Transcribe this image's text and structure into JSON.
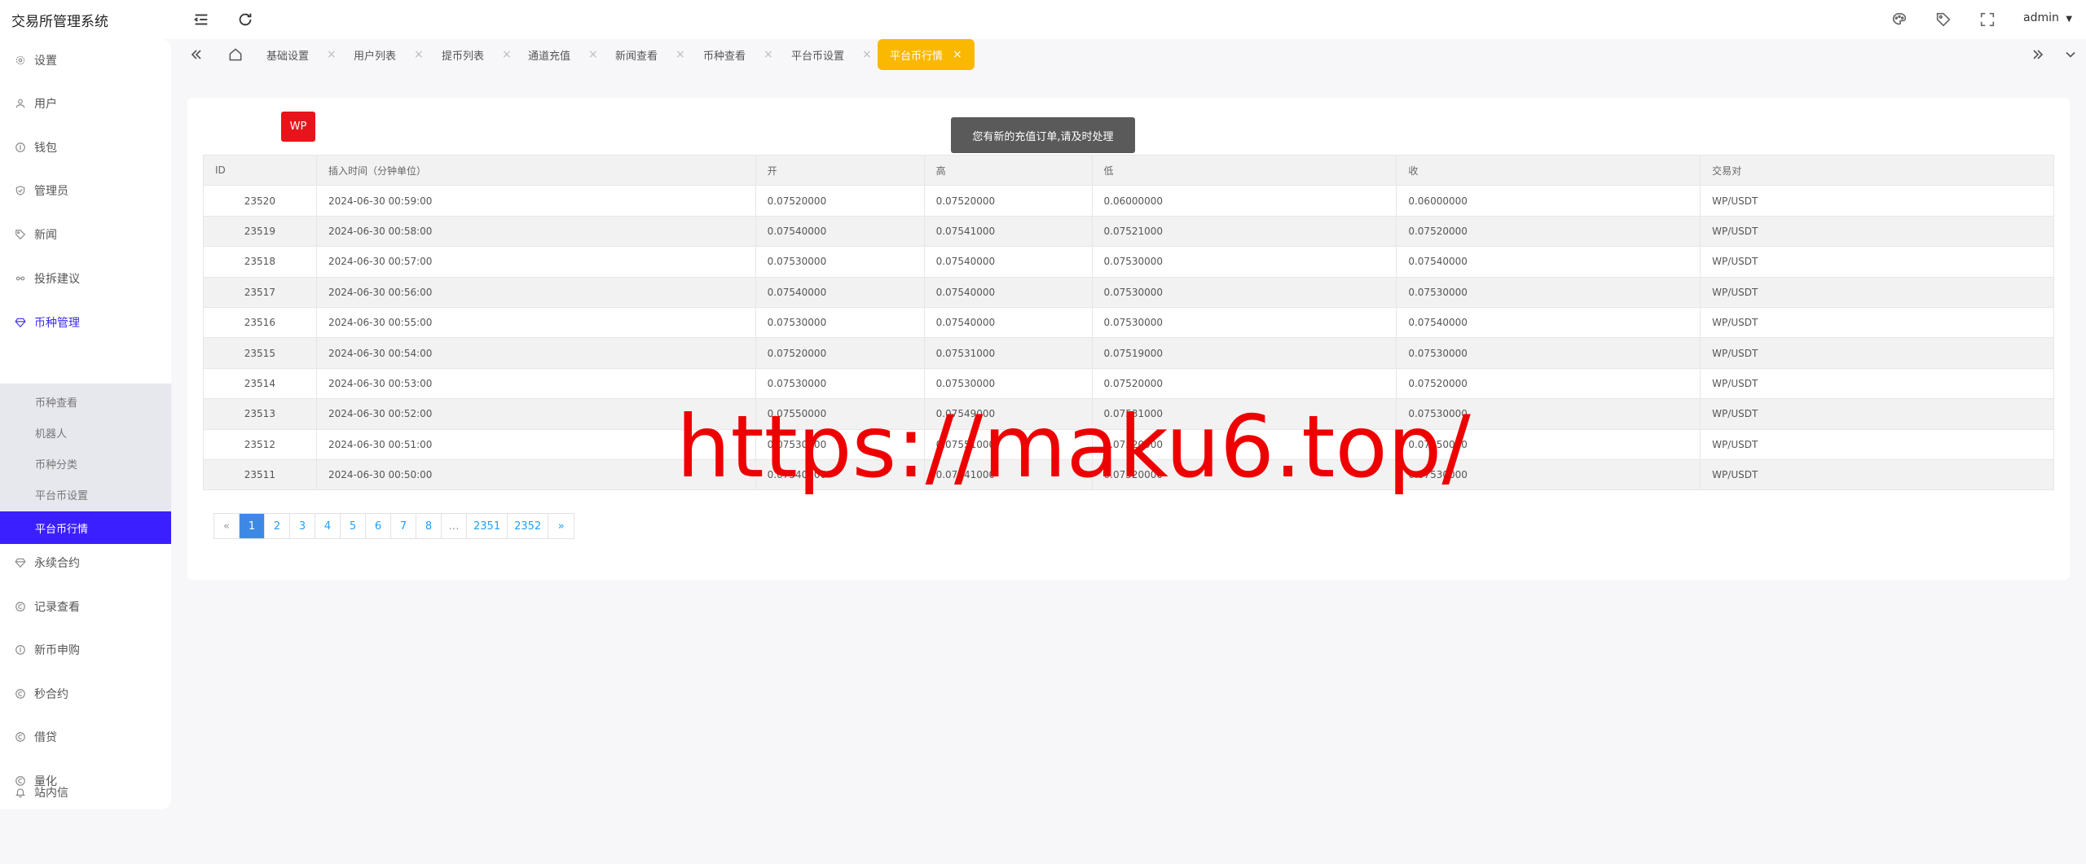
{
  "app": {
    "title": "交易所管理系统",
    "user": "admin"
  },
  "sidebar": {
    "items": [
      {
        "label": "设置",
        "icon": "gear-icon"
      },
      {
        "label": "用户",
        "icon": "user-icon"
      },
      {
        "label": "钱包",
        "icon": "wallet-icon"
      },
      {
        "label": "管理员",
        "icon": "shield-icon"
      },
      {
        "label": "新闻",
        "icon": "tag-icon"
      },
      {
        "label": "投拆建议",
        "icon": "link-icon"
      },
      {
        "label": "币种管理",
        "icon": "diamond-icon"
      },
      {
        "label": "永续合约",
        "icon": "diamond-icon"
      },
      {
        "label": "记录查看",
        "icon": "copyright-icon"
      },
      {
        "label": "新币申购",
        "icon": "wallet-icon"
      },
      {
        "label": "秒合约",
        "icon": "copyright-icon"
      },
      {
        "label": "借贷",
        "icon": "copyright-icon"
      },
      {
        "label": "量化",
        "icon": "copyright-icon"
      },
      {
        "label": "站内信",
        "icon": "bell-icon"
      }
    ],
    "submenu": [
      "币种查看",
      "机器人",
      "币种分类",
      "平台币设置",
      "平台币行情"
    ]
  },
  "tabs": [
    "基础设置",
    "用户列表",
    "提币列表",
    "通道充值",
    "新闻查看",
    "币种查看",
    "平台币设置",
    "平台币行情"
  ],
  "logo": {
    "text": "WP"
  },
  "toast": {
    "text": "您有新的充值订单,请及时处理"
  },
  "table": {
    "headers": [
      "ID",
      "插入时间（分钟单位）",
      "开",
      "高",
      "低",
      "收",
      "交易对"
    ],
    "rows": [
      [
        "23520",
        "2024-06-30 00:59:00",
        "0.07520000",
        "0.07520000",
        "0.06000000",
        "0.06000000",
        "WP/USDT"
      ],
      [
        "23519",
        "2024-06-30 00:58:00",
        "0.07540000",
        "0.07541000",
        "0.07521000",
        "0.07520000",
        "WP/USDT"
      ],
      [
        "23518",
        "2024-06-30 00:57:00",
        "0.07530000",
        "0.07540000",
        "0.07530000",
        "0.07540000",
        "WP/USDT"
      ],
      [
        "23517",
        "2024-06-30 00:56:00",
        "0.07540000",
        "0.07540000",
        "0.07530000",
        "0.07530000",
        "WP/USDT"
      ],
      [
        "23516",
        "2024-06-30 00:55:00",
        "0.07530000",
        "0.07540000",
        "0.07530000",
        "0.07540000",
        "WP/USDT"
      ],
      [
        "23515",
        "2024-06-30 00:54:00",
        "0.07520000",
        "0.07531000",
        "0.07519000",
        "0.07530000",
        "WP/USDT"
      ],
      [
        "23514",
        "2024-06-30 00:53:00",
        "0.07530000",
        "0.07530000",
        "0.07520000",
        "0.07520000",
        "WP/USDT"
      ],
      [
        "23513",
        "2024-06-30 00:52:00",
        "0.07550000",
        "0.07549000",
        "0.07531000",
        "0.07530000",
        "WP/USDT"
      ],
      [
        "23512",
        "2024-06-30 00:51:00",
        "0.07530000",
        "0.07551000",
        "0.07520000",
        "0.07550000",
        "WP/USDT"
      ],
      [
        "23511",
        "2024-06-30 00:50:00",
        "0.07540000",
        "0.07541000",
        "0.07520000",
        "0.07530000",
        "WP/USDT"
      ]
    ]
  },
  "pagination": {
    "prev": "«",
    "pages": [
      "1",
      "2",
      "3",
      "4",
      "5",
      "6",
      "7",
      "8",
      "…",
      "2351",
      "2352"
    ],
    "next": "»",
    "current": "1"
  },
  "watermark": {
    "text": "https://maku6.top/"
  }
}
